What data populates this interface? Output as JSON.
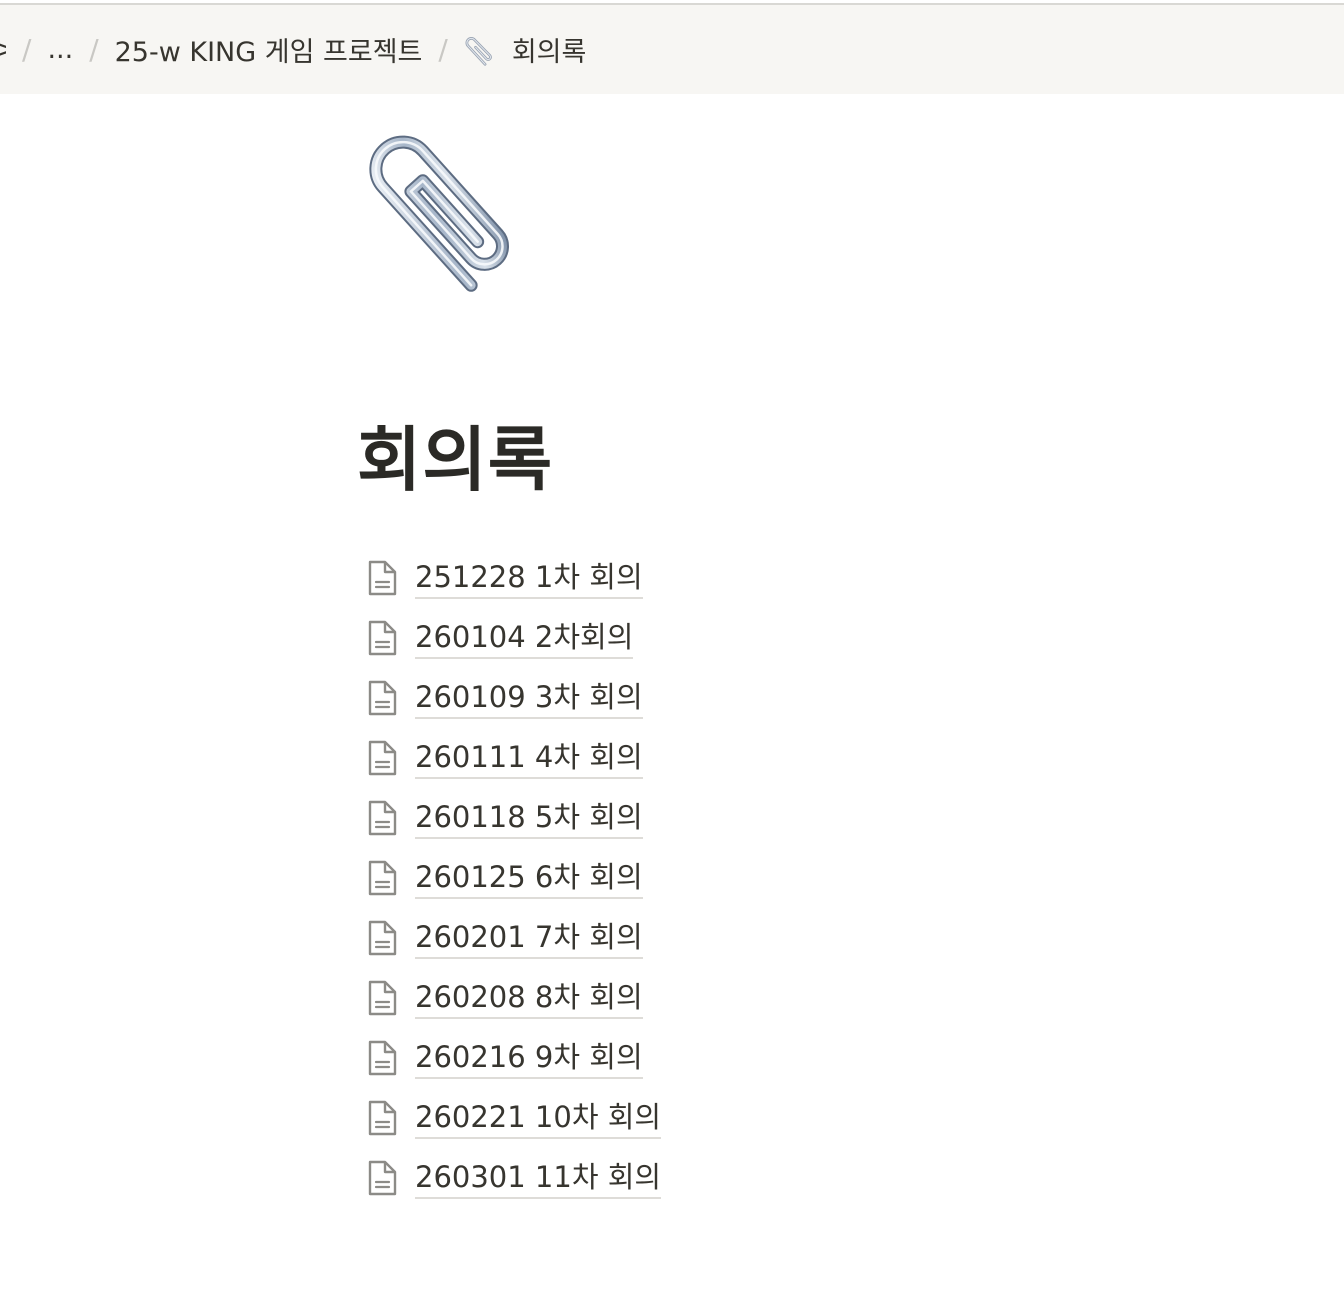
{
  "breadcrumb": {
    "partial_label": ">",
    "ellipsis": "...",
    "parent": "25-w KING 게임 프로젝트",
    "current": "회의록"
  },
  "page": {
    "icon": "paperclip-icon",
    "title": "회의록"
  },
  "subpages": [
    {
      "label": "251228 1차 회의"
    },
    {
      "label": "260104 2차회의"
    },
    {
      "label": "260109 3차 회의"
    },
    {
      "label": "260111 4차 회의"
    },
    {
      "label": "260118 5차 회의"
    },
    {
      "label": "260125 6차 회의"
    },
    {
      "label": "260201 7차 회의"
    },
    {
      "label": "260208 8차 회의"
    },
    {
      "label": "260216 9차 회의"
    },
    {
      "label": "260221 10차 회의"
    },
    {
      "label": "260301 11차 회의"
    }
  ],
  "colors": {
    "topbar_bg": "#f7f6f3",
    "text": "#37352f",
    "separator": "#c9c8c4",
    "link_underline": "#dedcd8"
  }
}
